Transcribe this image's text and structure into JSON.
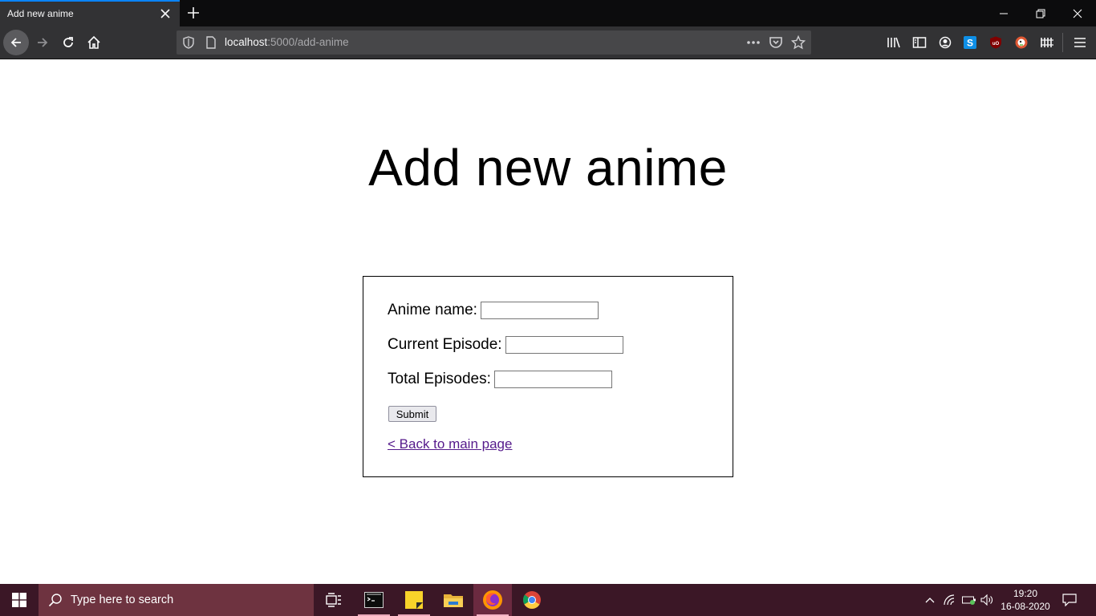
{
  "browser": {
    "tab_title": "Add new anime",
    "url_host": "localhost",
    "url_path": ":5000/add-anime"
  },
  "page": {
    "heading": "Add new anime",
    "form": {
      "anime_name_label": "Anime name:",
      "anime_name_value": "",
      "current_episode_label": "Current Episode:",
      "current_episode_value": "",
      "total_episodes_label": "Total Episodes:",
      "total_episodes_value": "",
      "submit_label": "Submit"
    },
    "back_link": "< Back to main page"
  },
  "taskbar": {
    "search_placeholder": "Type here to search",
    "time": "19:20",
    "date": "16-08-2020"
  },
  "colors": {
    "tab_accent": "#0a84ff",
    "link_visited": "#551a8b",
    "taskbar_bg": "#3b1726"
  }
}
